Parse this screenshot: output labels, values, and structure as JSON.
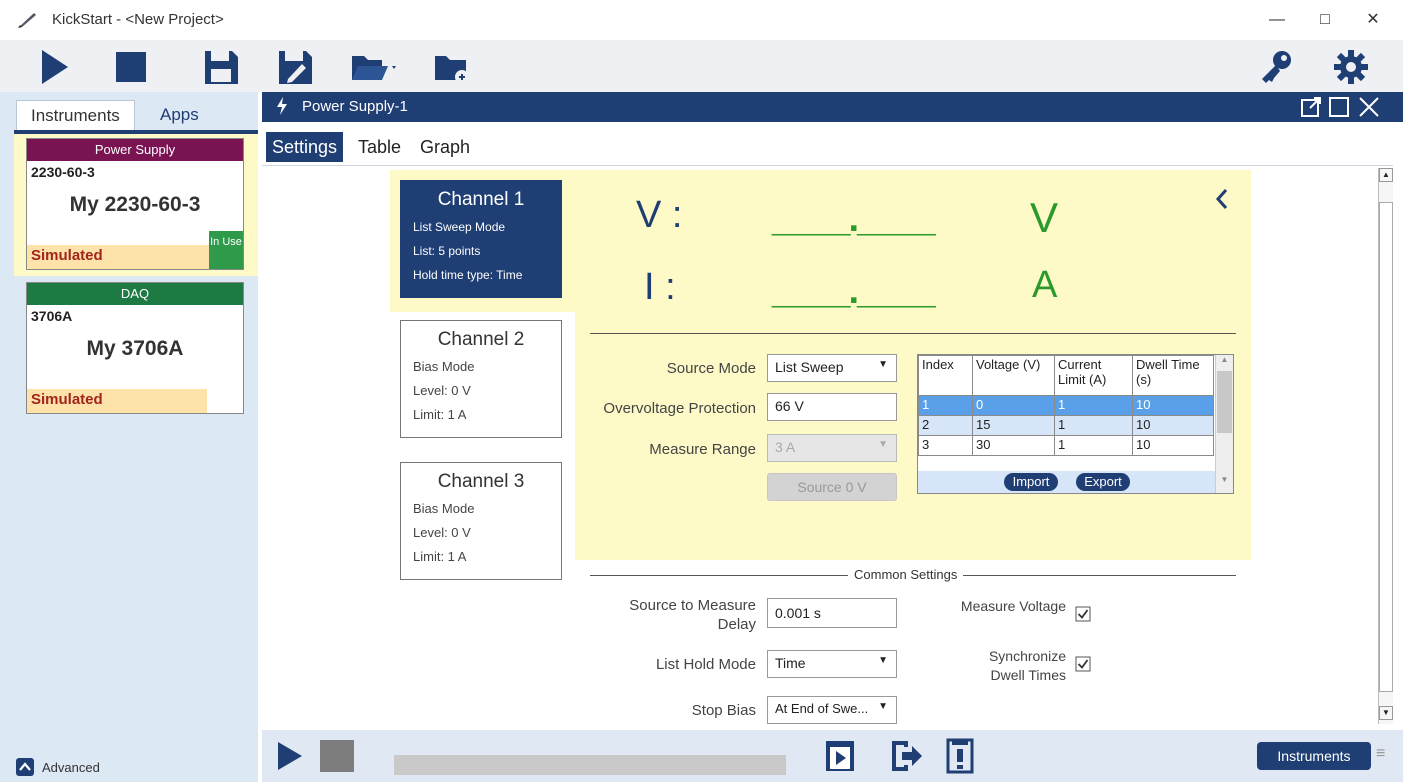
{
  "titlebar": {
    "title": "KickStart - <New Project>"
  },
  "left": {
    "tabs": [
      "Instruments",
      "Apps"
    ],
    "cards": [
      {
        "type": "Power Supply",
        "model": "2230-60-3",
        "name": "My 2230-60-3",
        "status": "Simulated",
        "badge": "In Use"
      },
      {
        "type": "DAQ",
        "model": "3706A",
        "name": "My 3706A",
        "status": "Simulated"
      }
    ],
    "advanced_label": "Advanced"
  },
  "panel": {
    "title": "Power Supply-1",
    "tabs": [
      "Settings",
      "Table",
      "Graph"
    ]
  },
  "channels": [
    {
      "name": "Channel 1",
      "lines": [
        "List Sweep Mode",
        "List: 5 points",
        "Hold time type: Time"
      ]
    },
    {
      "name": "Channel 2",
      "lines": [
        "Bias Mode",
        "Level: 0 V",
        "Limit: 1 A"
      ]
    },
    {
      "name": "Channel 3",
      "lines": [
        "Bias Mode",
        "Level: 0 V",
        "Limit: 1 A"
      ]
    }
  ],
  "readout": {
    "v_label": "V :",
    "v_value": "____.____",
    "v_unit": "V",
    "i_label": "I :",
    "i_value": "____.____",
    "i_unit": "A"
  },
  "settings": {
    "source_mode_label": "Source Mode",
    "source_mode_value": "List Sweep",
    "ovp_label": "Overvoltage Protection",
    "ovp_value": "66 V",
    "measure_range_label": "Measure Range",
    "measure_range_value": "3 A",
    "source_button": "Source 0 V"
  },
  "list_table": {
    "headers": [
      "Index",
      "Voltage (V)",
      "Current Limit (A)",
      "Dwell Time (s)"
    ],
    "rows": [
      [
        "1",
        "0",
        "1",
        "10"
      ],
      [
        "2",
        "15",
        "1",
        "10"
      ],
      [
        "3",
        "30",
        "1",
        "10"
      ]
    ],
    "import_label": "Import",
    "export_label": "Export"
  },
  "common": {
    "heading": "Common Settings",
    "delay_label": "Source to Measure Delay",
    "delay_value": "0.001 s",
    "hold_mode_label": "List Hold Mode",
    "hold_mode_value": "Time",
    "stop_bias_label": "Stop Bias",
    "stop_bias_value": "At End of Swe...",
    "measure_voltage_label": "Measure Voltage",
    "sync_dwell_label": "Synchronize Dwell Times"
  },
  "bottom": {
    "instruments_button": "Instruments"
  },
  "colors": {
    "navy": "#1f3e73",
    "green_readout": "#2a9a2a",
    "power_supply_header": "#7a1352",
    "daq_header": "#1e7a43",
    "yellow_panel": "#fdfac8",
    "selection_blue": "#5aa0e8"
  }
}
